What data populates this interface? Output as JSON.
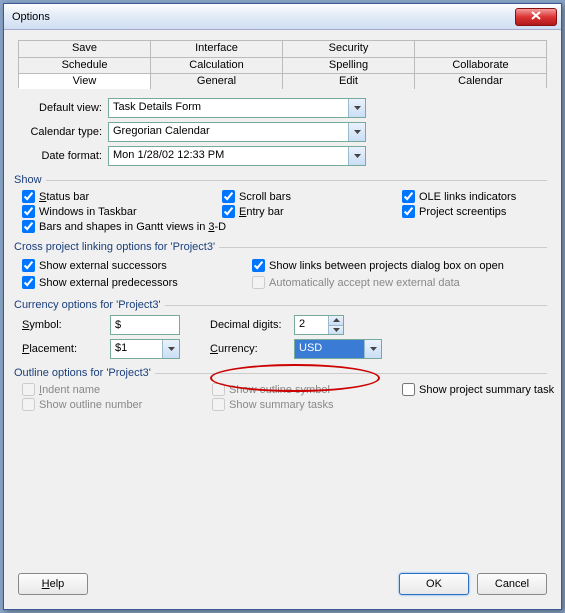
{
  "window": {
    "title": "Options"
  },
  "tabs": {
    "row1": [
      "Save",
      "Interface",
      "Security",
      ""
    ],
    "row2": [
      "Schedule",
      "Calculation",
      "Spelling",
      "Collaborate"
    ],
    "row3": [
      "View",
      "General",
      "Edit",
      "Calendar"
    ],
    "active": "View"
  },
  "form": {
    "default_view_label": "Default view:",
    "default_view_value": "Task Details Form",
    "calendar_type_label": "Calendar type:",
    "calendar_type_value": "Gregorian Calendar",
    "date_format_label": "Date format:",
    "date_format_value": "Mon 1/28/02 12:33 PM"
  },
  "show": {
    "legend": "Show",
    "status_bar": "Status bar",
    "windows_in_taskbar": "Windows in Taskbar",
    "bars_shapes_3d_pre": "Bars and shapes in Gantt views in ",
    "bars_shapes_3d_u": "3",
    "bars_shapes_3d_post": "-D",
    "scroll_bars": "Scroll bars",
    "entry_bar": "Entry bar",
    "ole_links": "OLE links indicators",
    "project_screentips": "Project screentips"
  },
  "cross": {
    "legend": "Cross project linking options for 'Project3'",
    "show_ext_succ": "Show external successors",
    "show_ext_pred": "Show external predecessors",
    "show_links_dialog": "Show links between projects dialog box on open",
    "auto_accept": "Automatically accept new external data"
  },
  "currency": {
    "legend": "Currency options for 'Project3'",
    "symbol_label": "Symbol:",
    "symbol_value": "$",
    "decimal_label": "Decimal digits:",
    "decimal_value": "2",
    "placement_label": "Placement:",
    "placement_value": "$1",
    "currency_label": "Currency:",
    "currency_value": "USD"
  },
  "outline": {
    "legend": "Outline options for 'Project3'",
    "indent_name": "Indent name",
    "show_outline_number": "Show outline number",
    "show_outline_symbol": "Show outline symbol",
    "show_summary_tasks": "Show summary tasks",
    "show_project_summary": "Show project summary task"
  },
  "buttons": {
    "help": "Help",
    "ok": "OK",
    "cancel": "Cancel"
  }
}
